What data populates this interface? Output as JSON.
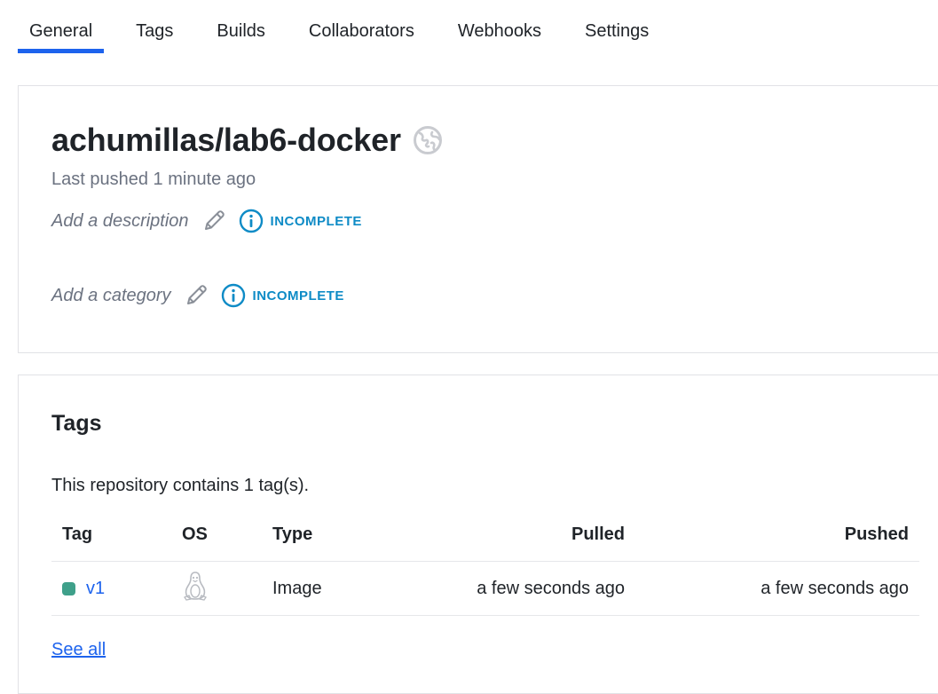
{
  "tabs": [
    {
      "label": "General",
      "active": true
    },
    {
      "label": "Tags",
      "active": false
    },
    {
      "label": "Builds",
      "active": false
    },
    {
      "label": "Collaborators",
      "active": false
    },
    {
      "label": "Webhooks",
      "active": false
    },
    {
      "label": "Settings",
      "active": false
    }
  ],
  "repo": {
    "name": "achumillas/lab6-docker",
    "visibility_icon": "globe-public-icon",
    "last_pushed": "Last pushed 1 minute ago",
    "description_placeholder": "Add a description",
    "description_status": "INCOMPLETE",
    "category_placeholder": "Add a category",
    "category_status": "INCOMPLETE"
  },
  "tags_section": {
    "heading": "Tags",
    "count_text": "This repository contains 1 tag(s).",
    "columns": {
      "tag": "Tag",
      "os": "OS",
      "type": "Type",
      "pulled": "Pulled",
      "pushed": "Pushed"
    },
    "rows": [
      {
        "tag": "v1",
        "os_icon": "linux-icon",
        "type": "Image",
        "pulled": "a few seconds ago",
        "pushed": "a few seconds ago"
      }
    ],
    "see_all": "See all"
  },
  "colors": {
    "accent": "#1d63ed",
    "incomplete": "#0e8bc6",
    "tag_dot": "#3fa08a",
    "muted_text": "#6b7280"
  }
}
